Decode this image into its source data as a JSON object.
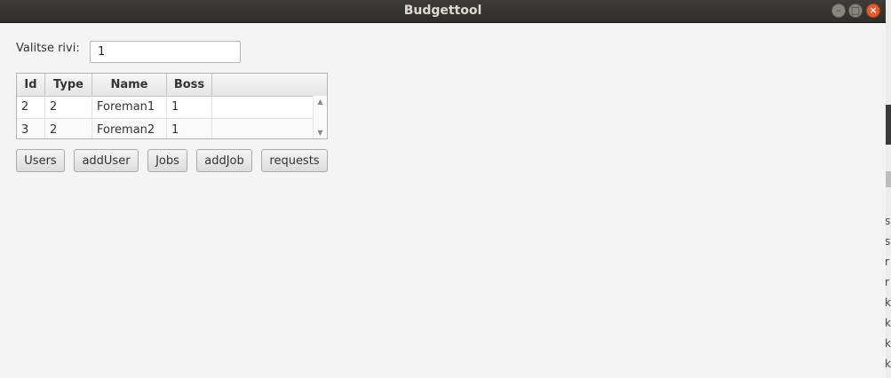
{
  "window": {
    "title": "Budgettool"
  },
  "form": {
    "row_label": "Valitse rivi:",
    "row_value": "1"
  },
  "table": {
    "columns": [
      "Id",
      "Type",
      "Name",
      "Boss"
    ],
    "rows": [
      [
        "2",
        "2",
        "Foreman1",
        "1"
      ],
      [
        "3",
        "2",
        "Foreman2",
        "1"
      ]
    ]
  },
  "buttons": {
    "users": "Users",
    "add_user": "addUser",
    "jobs": "Jobs",
    "add_job": "addJob",
    "requests": "requests"
  },
  "background_window_text": [
    "s",
    "s",
    "r",
    "r",
    "k",
    "k",
    "k",
    "k"
  ]
}
